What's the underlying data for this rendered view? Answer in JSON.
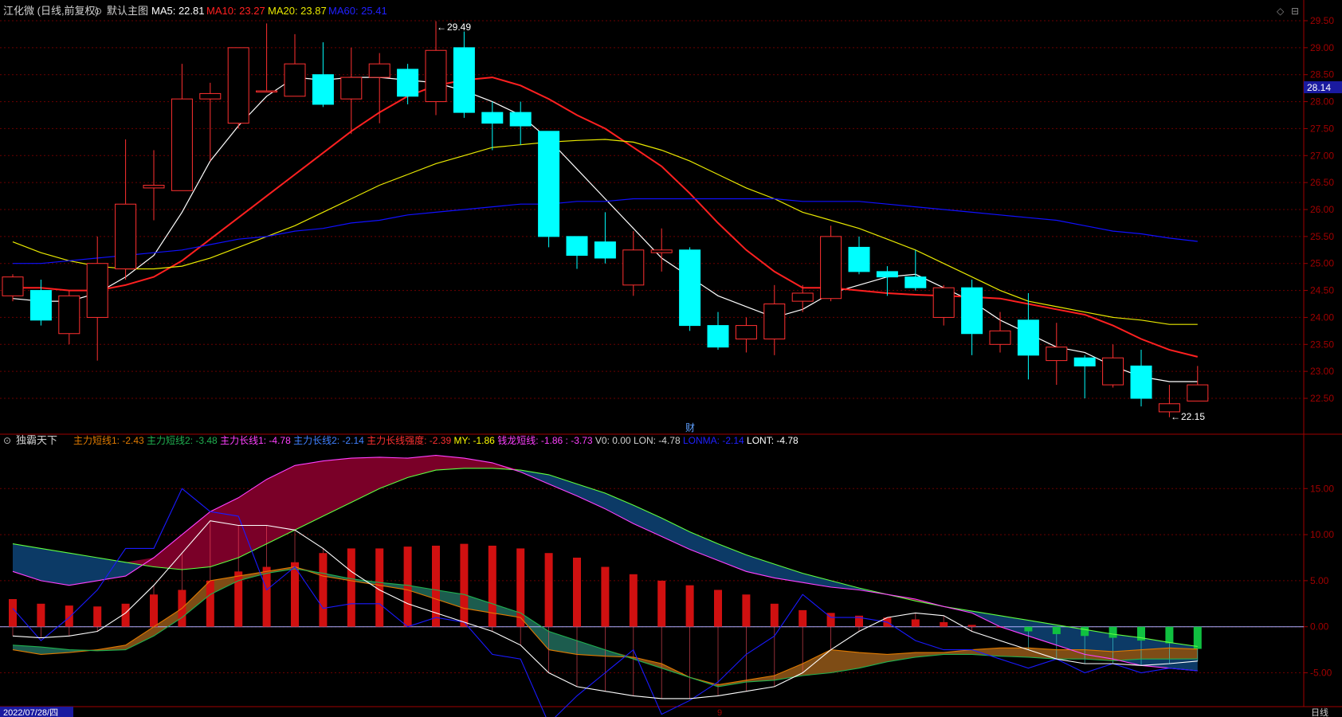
{
  "colors": {
    "background": "#000000",
    "grid": "#6b0000",
    "axis": "#a00000",
    "up": "#ff3030",
    "down": "#00ffff",
    "ma5": "#ffffff",
    "ma10": "#ff2020",
    "ma20": "#e8e800",
    "ma60": "#1010ff",
    "label": "#d0d0d0"
  },
  "main_header": {
    "stock": "江化微 (日线,前复权)",
    "panel": "默认主图",
    "ma5": "MA5: 22.81",
    "ma10": "MA10: 23.27",
    "ma20": "MA20: 23.87",
    "ma60": "MA60: 25.41"
  },
  "sub_header": {
    "panel": "独霸天下",
    "items": [
      {
        "text": "主力短线1: -2.43",
        "color": "#e07a00"
      },
      {
        "text": "主力短线2: -3.48",
        "color": "#20b050"
      },
      {
        "text": "主力长线1: -4.78",
        "color": "#ff40ff"
      },
      {
        "text": "主力长线2: -2.14",
        "color": "#4080ff"
      },
      {
        "text": "主力长线强度: -2.39",
        "color": "#ff3030"
      },
      {
        "text": "MY: -1.86",
        "color": "#ffff00"
      },
      {
        "text": "钱龙短线: -1.86 : -3.73",
        "color": "#ff40ff"
      },
      {
        "text": "V0: 0.00",
        "color": "#d0d0d0"
      },
      {
        "text": "LON: -4.78",
        "color": "#d0d0d0"
      },
      {
        "text": "LONMA: -2.14",
        "color": "#2020ff"
      },
      {
        "text": "LONT: -4.78",
        "color": "#ffffff"
      }
    ]
  },
  "annotations": {
    "high": "29.49",
    "low": "22.15",
    "marker": "财",
    "date": "2022/07/28/四",
    "month": "9",
    "period": "日线",
    "current_price": "28.14"
  },
  "chart_data": [
    {
      "type": "candlestick",
      "title": "江化微 (日线,前复权)",
      "ylim": [
        22.0,
        29.8
      ],
      "y_ticks": [
        22.5,
        23.0,
        23.5,
        24.0,
        24.5,
        25.0,
        25.5,
        26.0,
        26.5,
        27.0,
        27.5,
        28.0,
        28.5,
        29.0,
        29.5
      ],
      "y_tick_labels": [
        "22.50",
        "23.00",
        "23.50",
        "24.00",
        "24.50",
        "25.00",
        "25.50",
        "26.00",
        "26.50",
        "27.00",
        "27.50",
        "28.00",
        "28.50",
        "29.00",
        "29.50"
      ],
      "candles": [
        {
          "o": 24.4,
          "c": 24.75,
          "h": 24.8,
          "l": 24.3
        },
        {
          "o": 24.5,
          "c": 23.95,
          "h": 24.7,
          "l": 23.85
        },
        {
          "o": 23.7,
          "c": 24.4,
          "h": 24.5,
          "l": 23.5
        },
        {
          "o": 24.0,
          "c": 25.0,
          "h": 25.5,
          "l": 23.2
        },
        {
          "o": 24.9,
          "c": 26.1,
          "h": 27.3,
          "l": 24.7
        },
        {
          "o": 26.4,
          "c": 26.45,
          "h": 27.1,
          "l": 25.8
        },
        {
          "o": 26.35,
          "c": 28.05,
          "h": 28.7,
          "l": 26.35
        },
        {
          "o": 28.05,
          "c": 28.15,
          "h": 28.35,
          "l": 26.9
        },
        {
          "o": 27.6,
          "c": 29.0,
          "h": 29.0,
          "l": 27.5
        },
        {
          "o": 28.2,
          "c": 28.2,
          "h": 29.45,
          "l": 28.2
        },
        {
          "o": 28.1,
          "c": 28.7,
          "h": 29.25,
          "l": 28.1
        },
        {
          "o": 28.5,
          "c": 27.95,
          "h": 29.1,
          "l": 27.9
        },
        {
          "o": 28.05,
          "c": 28.45,
          "h": 29.0,
          "l": 27.4
        },
        {
          "o": 28.45,
          "c": 28.7,
          "h": 28.9,
          "l": 27.6
        },
        {
          "o": 28.6,
          "c": 28.1,
          "h": 28.7,
          "l": 27.95
        },
        {
          "o": 28.0,
          "c": 28.95,
          "h": 29.49,
          "l": 27.75
        },
        {
          "o": 29.0,
          "c": 27.8,
          "h": 29.3,
          "l": 27.7
        },
        {
          "o": 27.8,
          "c": 27.6,
          "h": 28.0,
          "l": 27.1
        },
        {
          "o": 27.8,
          "c": 27.55,
          "h": 28.0,
          "l": 27.2
        },
        {
          "o": 27.45,
          "c": 25.5,
          "h": 27.45,
          "l": 25.3
        },
        {
          "o": 25.5,
          "c": 25.15,
          "h": 25.5,
          "l": 24.9
        },
        {
          "o": 25.4,
          "c": 25.1,
          "h": 25.95,
          "l": 25.0
        },
        {
          "o": 24.6,
          "c": 25.25,
          "h": 25.6,
          "l": 24.4
        },
        {
          "o": 25.2,
          "c": 25.25,
          "h": 25.65,
          "l": 24.85
        },
        {
          "o": 25.25,
          "c": 23.85,
          "h": 25.3,
          "l": 23.75
        },
        {
          "o": 23.85,
          "c": 23.45,
          "h": 24.1,
          "l": 23.4
        },
        {
          "o": 23.6,
          "c": 23.85,
          "h": 24.0,
          "l": 23.35
        },
        {
          "o": 23.6,
          "c": 24.25,
          "h": 24.6,
          "l": 23.3
        },
        {
          "o": 24.3,
          "c": 24.45,
          "h": 24.6,
          "l": 24.1
        },
        {
          "o": 24.35,
          "c": 25.5,
          "h": 25.7,
          "l": 24.3
        },
        {
          "o": 25.3,
          "c": 24.85,
          "h": 25.5,
          "l": 24.8
        },
        {
          "o": 24.85,
          "c": 24.75,
          "h": 24.95,
          "l": 24.4
        },
        {
          "o": 24.75,
          "c": 24.55,
          "h": 25.25,
          "l": 24.5
        },
        {
          "o": 24.0,
          "c": 24.55,
          "h": 24.6,
          "l": 23.85
        },
        {
          "o": 24.55,
          "c": 23.7,
          "h": 24.7,
          "l": 23.3
        },
        {
          "o": 23.5,
          "c": 23.75,
          "h": 24.1,
          "l": 23.35
        },
        {
          "o": 23.95,
          "c": 23.3,
          "h": 24.45,
          "l": 22.85
        },
        {
          "o": 23.2,
          "c": 23.45,
          "h": 23.9,
          "l": 22.75
        },
        {
          "o": 23.25,
          "c": 23.1,
          "h": 23.3,
          "l": 22.5
        },
        {
          "o": 22.75,
          "c": 23.25,
          "h": 23.5,
          "l": 22.7
        },
        {
          "o": 23.1,
          "c": 22.5,
          "h": 23.4,
          "l": 22.35
        },
        {
          "o": 22.25,
          "c": 22.4,
          "h": 22.75,
          "l": 22.15
        },
        {
          "o": 22.45,
          "c": 22.75,
          "h": 23.1,
          "l": 22.45
        }
      ],
      "series": [
        {
          "name": "MA5",
          "values": [
            24.35,
            24.3,
            24.3,
            24.45,
            24.75,
            25.15,
            25.95,
            26.9,
            27.55,
            28.1,
            28.45,
            28.4,
            28.45,
            28.45,
            28.4,
            28.35,
            28.2,
            28.0,
            27.75,
            27.3,
            26.75,
            26.2,
            25.65,
            25.1,
            24.75,
            24.4,
            24.2,
            24.0,
            24.15,
            24.45,
            24.6,
            24.75,
            24.8,
            24.55,
            24.3,
            23.95,
            23.7,
            23.45,
            23.35,
            23.1,
            22.9,
            22.81,
            22.81
          ]
        },
        {
          "name": "MA10",
          "values": [
            24.55,
            24.55,
            24.5,
            24.5,
            24.6,
            24.75,
            25.05,
            25.45,
            25.85,
            26.25,
            26.65,
            27.05,
            27.45,
            27.8,
            28.1,
            28.3,
            28.4,
            28.45,
            28.3,
            28.05,
            27.75,
            27.5,
            27.15,
            26.8,
            26.3,
            25.75,
            25.25,
            24.85,
            24.55,
            24.55,
            24.5,
            24.45,
            24.42,
            24.4,
            24.38,
            24.35,
            24.25,
            24.15,
            24.05,
            23.85,
            23.6,
            23.4,
            23.27
          ]
        },
        {
          "name": "MA20",
          "values": [
            25.4,
            25.2,
            25.05,
            24.95,
            24.9,
            24.9,
            24.95,
            25.1,
            25.3,
            25.5,
            25.7,
            25.95,
            26.2,
            26.45,
            26.65,
            26.85,
            27.0,
            27.15,
            27.2,
            27.25,
            27.28,
            27.3,
            27.25,
            27.1,
            26.9,
            26.65,
            26.4,
            26.2,
            25.95,
            25.8,
            25.65,
            25.45,
            25.25,
            25.0,
            24.75,
            24.5,
            24.3,
            24.2,
            24.1,
            24.0,
            23.95,
            23.87,
            23.87
          ]
        },
        {
          "name": "MA60",
          "values": [
            25.0,
            25.0,
            25.05,
            25.1,
            25.15,
            25.2,
            25.25,
            25.35,
            25.45,
            25.5,
            25.6,
            25.65,
            25.75,
            25.8,
            25.9,
            25.95,
            26.0,
            26.05,
            26.1,
            26.1,
            26.15,
            26.15,
            26.2,
            26.2,
            26.2,
            26.2,
            26.2,
            26.2,
            26.15,
            26.15,
            26.15,
            26.1,
            26.05,
            26.0,
            25.95,
            25.9,
            25.85,
            25.8,
            25.7,
            25.6,
            25.55,
            25.47,
            25.41
          ]
        }
      ]
    },
    {
      "type": "indicator",
      "title": "独霸天下",
      "ylim": [
        -8.5,
        19.0
      ],
      "y_ticks": [
        -5,
        0,
        5,
        10,
        15
      ],
      "y_tick_labels": [
        "-5.00",
        "0.00",
        "5.00",
        "10.00",
        "15.00"
      ],
      "histogram": [
        3.0,
        2.5,
        2.3,
        2.2,
        2.5,
        3.5,
        4.0,
        5.0,
        6.0,
        6.5,
        7.0,
        8.0,
        8.5,
        8.5,
        8.7,
        8.8,
        9.0,
        8.8,
        8.5,
        8.0,
        7.5,
        6.5,
        5.7,
        5.0,
        4.5,
        4.0,
        3.5,
        2.5,
        1.8,
        1.5,
        1.2,
        1.0,
        0.8,
        0.5,
        0.2,
        0.0,
        -0.5,
        -0.8,
        -1.0,
        -1.2,
        -1.5,
        -1.8,
        -2.4
      ],
      "series": [
        {
          "name": "主力短线1",
          "values": [
            -2.5,
            -3.0,
            -2.8,
            -2.5,
            -2.0,
            0.0,
            2.0,
            5.0,
            5.5,
            6.0,
            6.5,
            5.5,
            5.0,
            4.5,
            4.0,
            3.0,
            2.0,
            1.5,
            1.0,
            -2.5,
            -3.0,
            -3.2,
            -3.3,
            -4.0,
            -5.5,
            -6.3,
            -5.8,
            -5.3,
            -4.0,
            -2.5,
            -2.8,
            -3.0,
            -2.8,
            -2.8,
            -2.5,
            -2.3,
            -2.3,
            -2.5,
            -2.5,
            -2.7,
            -2.5,
            -2.3,
            -2.43
          ]
        },
        {
          "name": "主力短线2",
          "values": [
            -2.0,
            -2.2,
            -2.5,
            -2.6,
            -2.5,
            -1.0,
            1.0,
            3.5,
            5.0,
            5.8,
            6.3,
            5.8,
            5.2,
            4.8,
            4.5,
            4.0,
            3.5,
            2.5,
            1.5,
            -0.5,
            -1.5,
            -2.5,
            -3.5,
            -4.5,
            -5.5,
            -6.5,
            -6.0,
            -5.8,
            -5.3,
            -5.0,
            -4.5,
            -3.8,
            -3.3,
            -3.0,
            -3.0,
            -3.2,
            -3.3,
            -3.5,
            -3.5,
            -3.7,
            -3.5,
            -3.5,
            -3.48
          ]
        },
        {
          "name": "主力长线1",
          "values": [
            6.0,
            5.0,
            4.5,
            5.0,
            5.5,
            7.5,
            10.0,
            12.5,
            14.0,
            16.0,
            17.5,
            18.0,
            18.3,
            18.4,
            18.3,
            18.6,
            18.3,
            17.8,
            16.8,
            15.5,
            14.2,
            12.8,
            11.2,
            9.8,
            8.4,
            7.2,
            6.0,
            5.3,
            4.8,
            4.3,
            4.0,
            3.5,
            3.0,
            2.2,
            1.5,
            0.0,
            -1.0,
            -2.0,
            -3.0,
            -3.5,
            -4.2,
            -4.5,
            -4.78
          ]
        },
        {
          "name": "主力长线2",
          "values": [
            9.0,
            8.5,
            8.0,
            7.5,
            7.0,
            6.5,
            6.2,
            6.5,
            7.5,
            9.0,
            10.5,
            12.0,
            13.5,
            15.0,
            16.2,
            17.0,
            17.2,
            17.2,
            17.0,
            16.5,
            15.5,
            14.5,
            13.2,
            11.8,
            10.3,
            9.0,
            7.8,
            6.8,
            5.8,
            5.0,
            4.2,
            3.5,
            2.8,
            2.2,
            1.7,
            1.2,
            0.7,
            0.2,
            -0.3,
            -0.8,
            -1.2,
            -1.7,
            -2.14
          ]
        },
        {
          "name": "钱龙短线",
          "values": [
            -1.0,
            -1.2,
            -1.0,
            -0.5,
            1.5,
            4.5,
            8.0,
            11.5,
            11.0,
            11.0,
            10.5,
            8.5,
            6.0,
            4.0,
            2.5,
            1.5,
            0.5,
            -0.5,
            -2.0,
            -5.0,
            -6.5,
            -7.0,
            -7.5,
            -7.8,
            -7.8,
            -7.5,
            -7.0,
            -6.5,
            -5.0,
            -2.5,
            -0.5,
            1.0,
            1.5,
            1.2,
            -0.5,
            -1.5,
            -2.5,
            -3.5,
            -4.0,
            -4.0,
            -4.2,
            -4.0,
            -3.73
          ]
        },
        {
          "name": "LONMA",
          "values": [
            2.0,
            -1.5,
            1.0,
            4.0,
            8.5,
            8.5,
            15.0,
            12.5,
            12.0,
            4.0,
            6.5,
            2.0,
            2.5,
            2.5,
            0.0,
            1.0,
            0.5,
            -3.0,
            -3.5,
            -10.5,
            -7.5,
            -5.0,
            -2.5,
            -9.5,
            -8.0,
            -6.0,
            -3.0,
            -1.0,
            3.5,
            1.0,
            1.0,
            0.5,
            -1.5,
            -2.5,
            -2.5,
            -3.5,
            -4.5,
            -3.5,
            -5.0,
            -4.0,
            -5.0,
            -4.5,
            -4.78
          ]
        }
      ]
    }
  ]
}
